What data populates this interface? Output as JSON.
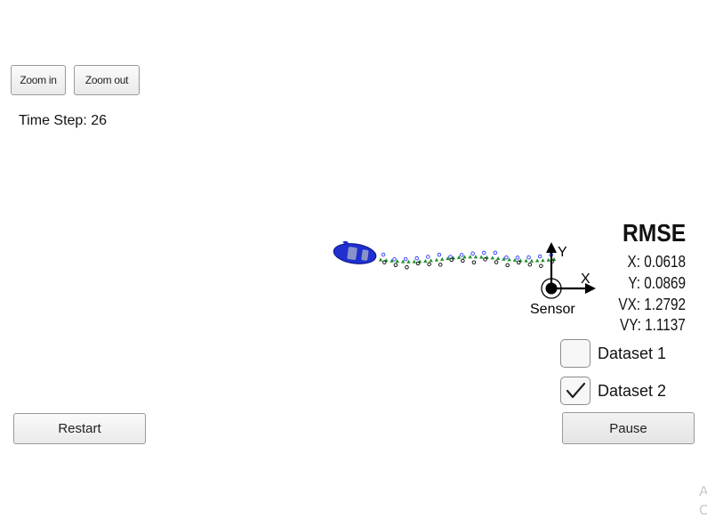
{
  "toolbar": {
    "zoom_in_label": "Zoom in",
    "zoom_out_label": "Zoom out"
  },
  "status": {
    "time_step_label": "Time Step: 26"
  },
  "scene": {
    "sensor_label": "Sensor",
    "x_axis_label": "X",
    "y_axis_label": "Y",
    "car_color": "#1f2fd0",
    "lidar_marker_color": "#2b3bff",
    "radar_marker_color": "#000000",
    "estimate_marker_color": "#1f8f2a"
  },
  "rmse": {
    "title": "RMSE",
    "x": "X: 0.0618",
    "y": "Y: 0.0869",
    "vx": "VX: 1.2792",
    "vy": "VY: 1.1137"
  },
  "datasets": [
    {
      "label": "Dataset 1",
      "checked": false
    },
    {
      "label": "Dataset 2",
      "checked": true
    }
  ],
  "controls": {
    "restart_label": "Restart",
    "pause_label": "Pause"
  },
  "corner_glyphs": [
    "A",
    "C"
  ]
}
